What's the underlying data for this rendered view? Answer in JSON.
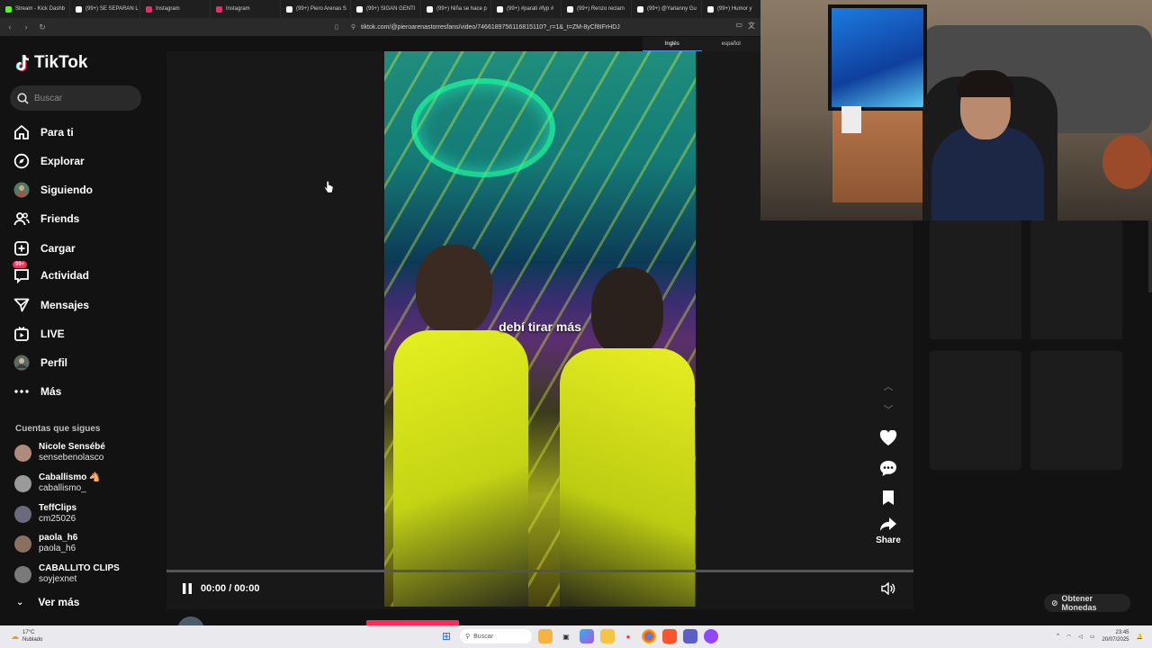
{
  "browser": {
    "tabs": [
      {
        "label": "Stream - Kick Dashb",
        "color": "#53fc18"
      },
      {
        "label": "(99+) SE SEPARAN L",
        "color": "#ffffff"
      },
      {
        "label": "Instagram",
        "color": "#e1306c"
      },
      {
        "label": "Instagram",
        "color": "#e1306c"
      },
      {
        "label": "(99+) Piero Arenas S",
        "color": "#ffffff"
      },
      {
        "label": "(99+) SIGAN GENTI",
        "color": "#ffffff"
      },
      {
        "label": "(99+) Niña se hace p",
        "color": "#ffffff"
      },
      {
        "label": "(99+) #parati #fyp #",
        "color": "#ffffff"
      },
      {
        "label": "(99+) Renzo reclam",
        "color": "#ffffff"
      },
      {
        "label": "(99+) @Yarianny Gu",
        "color": "#ffffff"
      },
      {
        "label": "(99+) Humor y",
        "color": "#ffffff"
      }
    ],
    "url": "tiktok.com/@pieroarenastorresfans/video/7466189756116815110?_r=1&_t=ZM-8yCf8IFrHDJ",
    "translate": {
      "source": "Inglés",
      "target": "español"
    }
  },
  "sidebar": {
    "logo": "TikTok",
    "search_placeholder": "Buscar",
    "items": [
      {
        "label": "Para ti",
        "icon": "home-icon"
      },
      {
        "label": "Explorar",
        "icon": "compass-icon"
      },
      {
        "label": "Siguiendo",
        "icon": "following-avatar"
      },
      {
        "label": "Friends",
        "icon": "friends-icon"
      },
      {
        "label": "Cargar",
        "icon": "upload-icon"
      },
      {
        "label": "Actividad",
        "icon": "activity-icon",
        "badge": "99+"
      },
      {
        "label": "Mensajes",
        "icon": "messages-icon"
      },
      {
        "label": "LIVE",
        "icon": "live-icon"
      },
      {
        "label": "Perfil",
        "icon": "profile-avatar"
      },
      {
        "label": "Más",
        "icon": "more-icon"
      }
    ],
    "following_title": "Cuentas que sigues",
    "following": [
      {
        "name": "Nicole Sensébé",
        "handle": "sensebenolasco"
      },
      {
        "name": "Caballismo 🐴",
        "handle": "caballismo_"
      },
      {
        "name": "TeffClips",
        "handle": "cm25026"
      },
      {
        "name": "paola_h6",
        "handle": "paola_h6"
      },
      {
        "name": "CABALLITO CLIPS",
        "handle": "soyjexnet"
      }
    ],
    "see_more": "Ver más"
  },
  "video": {
    "caption": "debí tirar más",
    "time": "00:00 / 00:00",
    "author": "pieroarenastorresfans",
    "share_label": "Share"
  },
  "right": {
    "coins_label": "Obtener Monedas"
  },
  "taskbar": {
    "weather_temp": "17°C",
    "weather_desc": "Nublado",
    "search_label": "Buscar",
    "time": "23:45",
    "date": "20/07/2025"
  },
  "colors": {
    "accent": "#fe2c55",
    "background": "#121212"
  }
}
